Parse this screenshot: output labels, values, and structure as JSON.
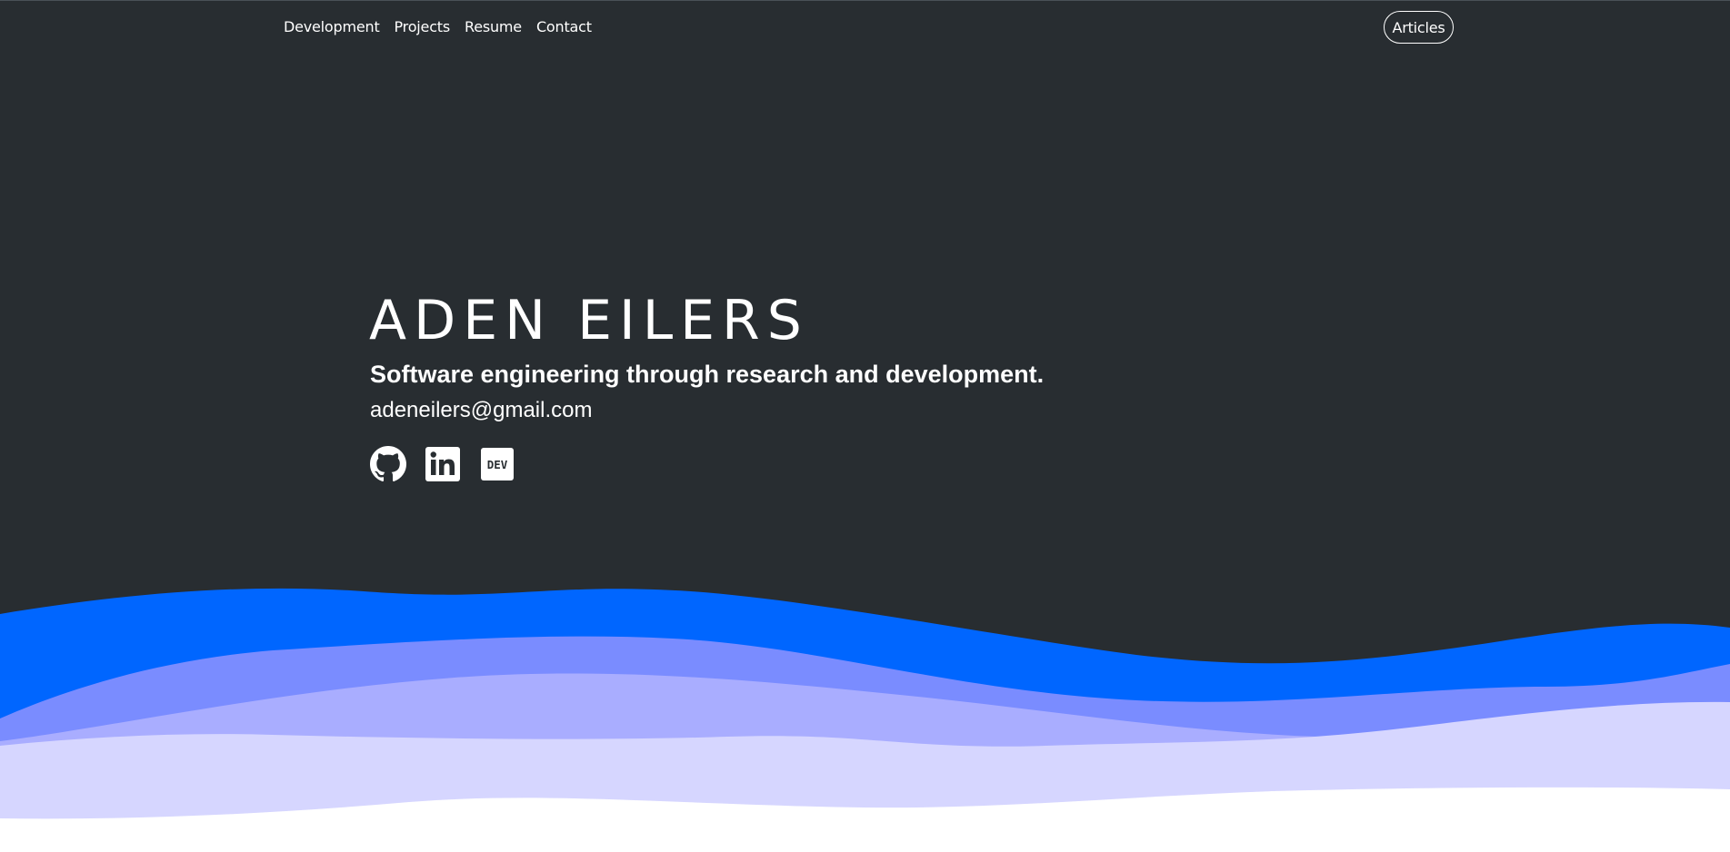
{
  "nav": {
    "items": [
      {
        "label": "Development"
      },
      {
        "label": "Projects"
      },
      {
        "label": "Resume"
      },
      {
        "label": "Contact"
      }
    ],
    "articles_label": "Articles"
  },
  "hero": {
    "name": "ADEN EILERS",
    "tagline": "Software engineering through research and development.",
    "email": "adeneilers@gmail.com",
    "socials": [
      {
        "icon": "github-icon"
      },
      {
        "icon": "linkedin-icon"
      },
      {
        "icon": "dev-icon",
        "text": "DEV"
      }
    ]
  },
  "colors": {
    "background": "#282d31",
    "text": "#ffffff",
    "wave_1": "#0066ff",
    "wave_2": "#7a8cff",
    "wave_3": "#a9adff",
    "wave_4": "#d6d6ff",
    "page_bottom": "#ffffff"
  }
}
